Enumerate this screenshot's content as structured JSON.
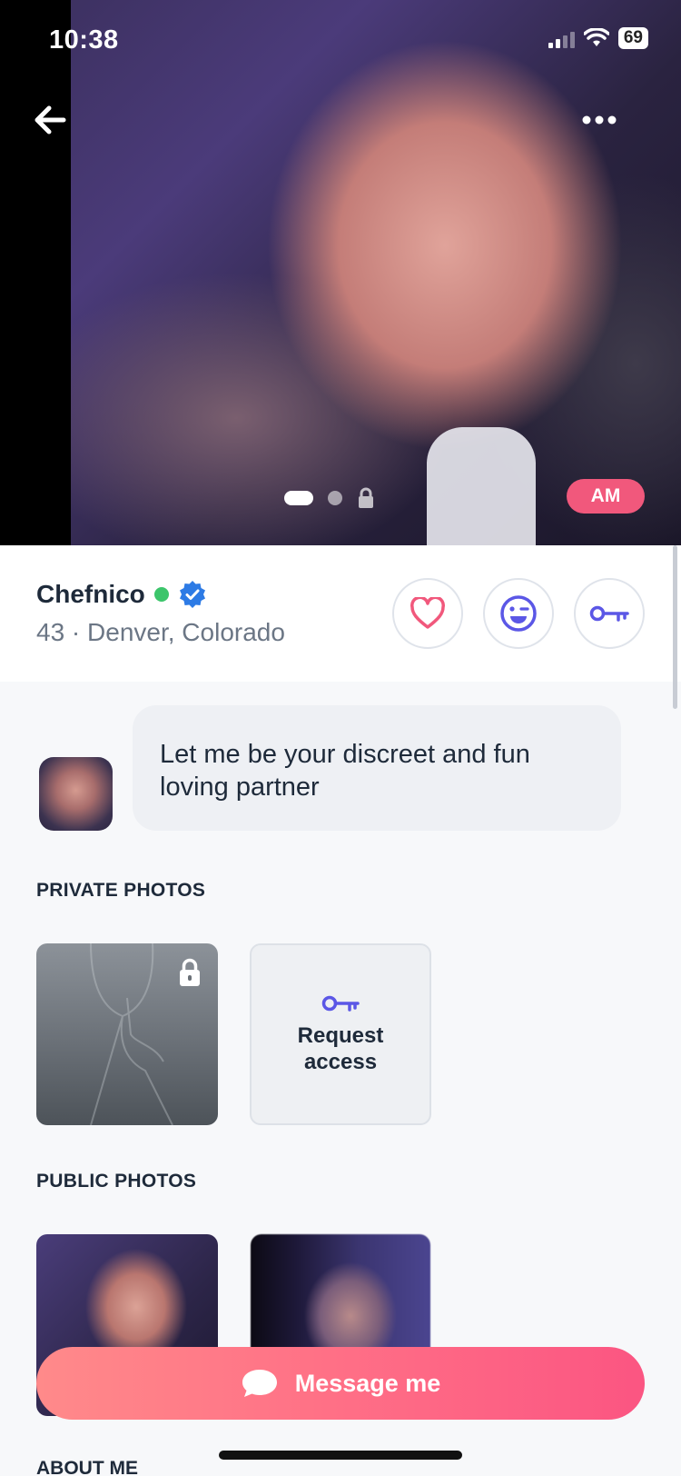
{
  "status_bar": {
    "time": "10:38",
    "battery": "69"
  },
  "hero": {
    "badge": "AM",
    "photo_count": 3,
    "active_photo": 1
  },
  "profile": {
    "name": "Chefnico",
    "online": true,
    "verified": true,
    "age_location": "43 · Denver, Colorado"
  },
  "actions": [
    "heart-icon",
    "smiley-icon",
    "key-icon"
  ],
  "bio": {
    "text": "Let me be your discreet and fun loving partner"
  },
  "private_photos": {
    "title": "PRIVATE PHOTOS",
    "request_label": "Request access"
  },
  "public_photos": {
    "title": "PUBLIC PHOTOS"
  },
  "message_button": {
    "label": "Message me"
  },
  "about": {
    "title": "ABOUT ME"
  },
  "colors": {
    "accent_pink": "#f1587c",
    "accent_purple": "#5b57e6",
    "online_green": "#3cc56b",
    "verified_blue": "#2d7be5"
  }
}
